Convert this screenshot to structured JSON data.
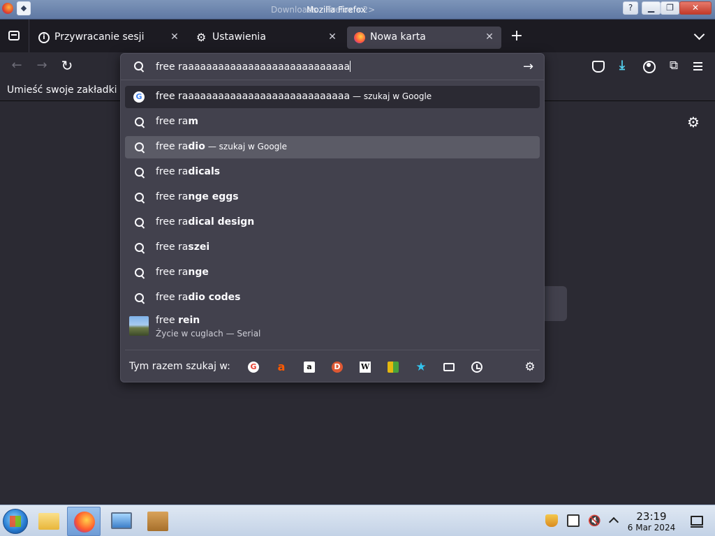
{
  "window": {
    "title": "Mozilla Firefox",
    "title_ghost": "Downloads - Firefox <2>",
    "help_label": "?",
    "close_label": "✕"
  },
  "tabs": [
    {
      "label": "Przywracanie sesji",
      "icon": "info-icon",
      "active": false
    },
    {
      "label": "Ustawienia",
      "icon": "gear-icon",
      "active": false
    },
    {
      "label": "Nowa karta",
      "icon": "firefox-icon",
      "active": true
    }
  ],
  "bookmarks": {
    "text": "Umieść swoje zakładki n"
  },
  "urlbar": {
    "value": "free raaaaaaaaaaaaaaaaaaaaaaaaaaaa"
  },
  "suggestions": [
    {
      "typed": "free raaaaaaaaaaaaaaaaaaaaaaaaaaaa",
      "bold": "",
      "suffix": "— szukaj w Google",
      "icon": "google-icon"
    },
    {
      "typed": "free ra",
      "bold": "m",
      "suffix": "",
      "icon": "search-icon"
    },
    {
      "typed": "free ra",
      "bold": "dio",
      "suffix": "— szukaj w Google",
      "icon": "search-icon"
    },
    {
      "typed": "free ra",
      "bold": "dicals",
      "suffix": "",
      "icon": "search-icon"
    },
    {
      "typed": "free ra",
      "bold": "nge eggs",
      "suffix": "",
      "icon": "search-icon"
    },
    {
      "typed": "free ra",
      "bold": "dical design",
      "suffix": "",
      "icon": "search-icon"
    },
    {
      "typed": "free ra",
      "bold": "szei",
      "suffix": "",
      "icon": "search-icon"
    },
    {
      "typed": "free ra",
      "bold": "nge",
      "suffix": "",
      "icon": "search-icon"
    },
    {
      "typed": "free ra",
      "bold": "dio codes",
      "suffix": "",
      "icon": "search-icon"
    },
    {
      "typed": "free ",
      "bold": "rein",
      "subtitle": "Życie w cuglach — Serial",
      "icon": "thumbnail"
    }
  ],
  "oneoff": {
    "label": "Tym razem szukaj w:",
    "engines": [
      "google",
      "allegro",
      "amazon",
      "duckduckgo",
      "wikipedia",
      "multi",
      "bookmarks",
      "tabs",
      "history"
    ]
  },
  "taskbar": {
    "time": "23:19",
    "date": "6 Mar 2024"
  },
  "colors": {
    "background": "#2b2a33",
    "panel": "#42414d",
    "selected_row": "#5b5b66",
    "accent_download": "#54d2f0"
  }
}
